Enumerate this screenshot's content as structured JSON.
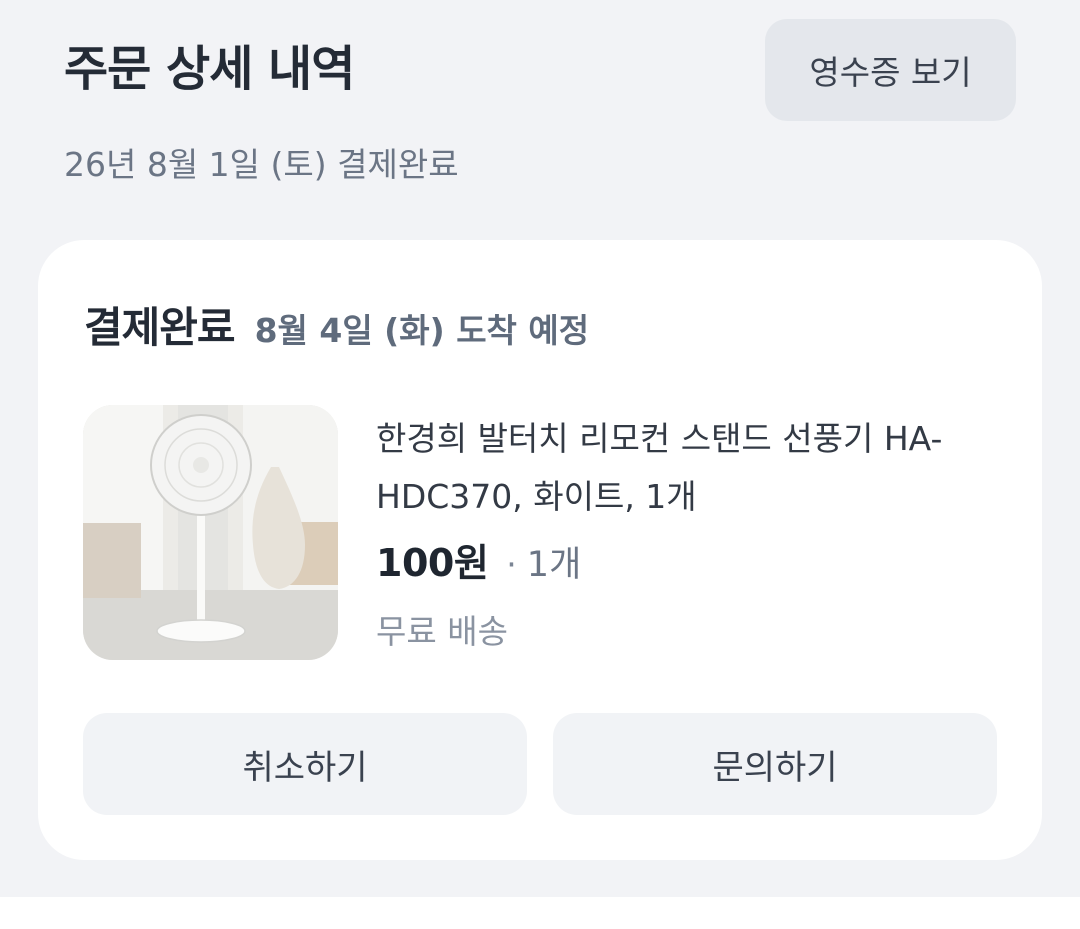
{
  "header": {
    "title": "주문 상세 내역",
    "receipt_button": "영수증 보기",
    "order_date": "26년 8월 1일 (토) 결제완료"
  },
  "order": {
    "status": "결제완료",
    "arrival": "8월 4일 (화) 도착 예정",
    "product": {
      "name": "한경희 발터치 리모컨 스탠드 선풍기 HA-HDC370, 화이트, 1개",
      "price": "100원",
      "separator": "·",
      "quantity": "1개",
      "shipping": "무료 배송",
      "thumbnail_icon": "stand-fan-photo"
    },
    "actions": {
      "cancel": "취소하기",
      "inquiry": "문의하기"
    }
  }
}
